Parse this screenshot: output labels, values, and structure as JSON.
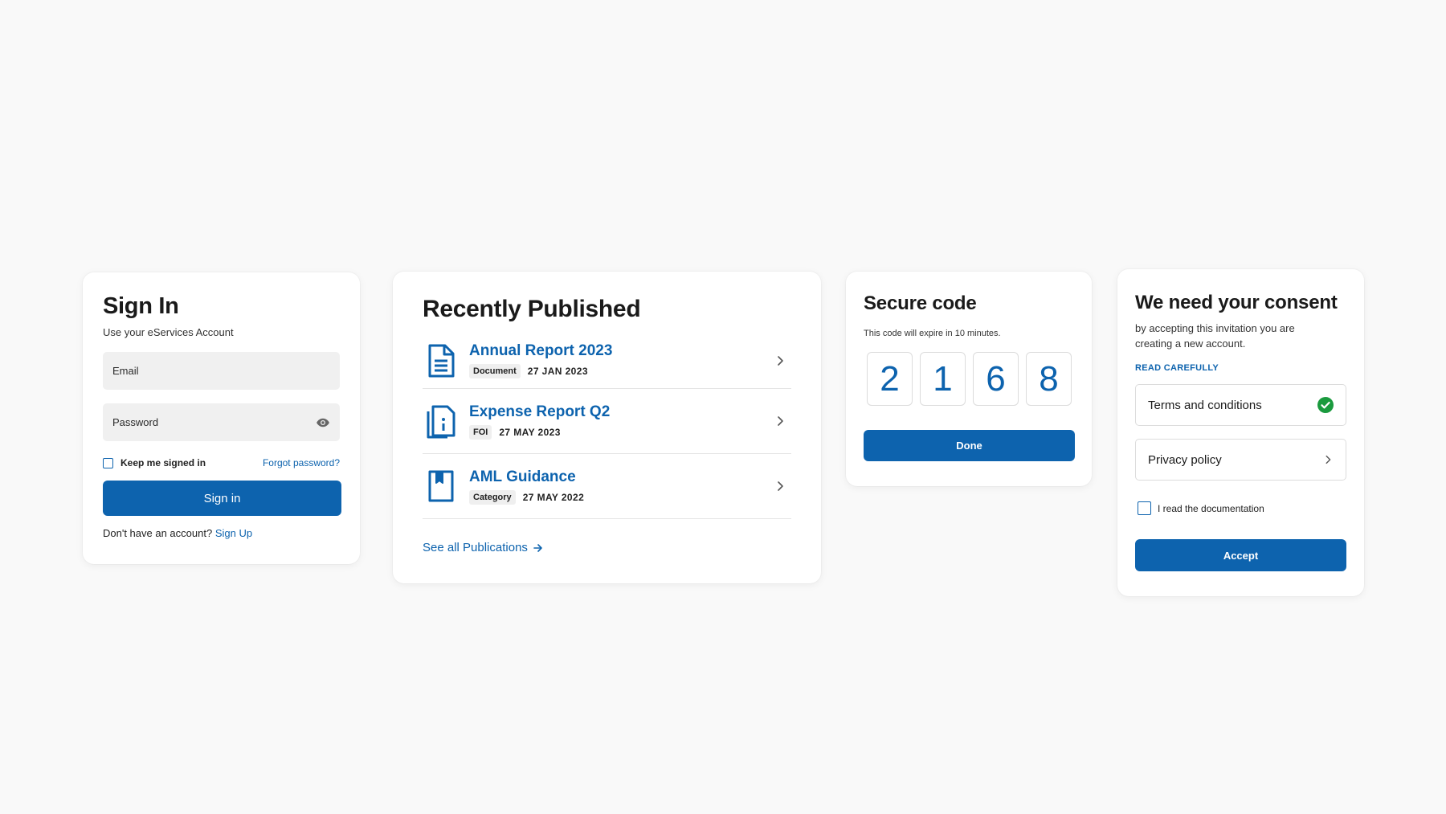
{
  "colors": {
    "accent": "#0d63ae",
    "success": "#1a9a3e",
    "background": "#f9f9f9"
  },
  "signin": {
    "title": "Sign In",
    "subtitle": "Use your eServices Account",
    "email_placeholder": "Email",
    "password_placeholder": "Password",
    "password_icon": "eye-icon",
    "keep_signed_in": "Keep me signed in",
    "forgot_password": "Forgot password?",
    "sign_in_button": "Sign in",
    "no_account": "Don't have an account?",
    "sign_up": "Sign Up"
  },
  "publications": {
    "title": "Recently Published",
    "items": [
      {
        "title": "Annual Report 2023",
        "tag": "Document",
        "date": "27 JAN 2023",
        "icon": "document-icon"
      },
      {
        "title": "Expense Report Q2",
        "tag": "FOI",
        "date": "27 MAY 2023",
        "icon": "info-document-icon"
      },
      {
        "title": "AML Guidance",
        "tag": "Category",
        "date": "27 MAY 2022",
        "icon": "bookmark-icon"
      }
    ],
    "see_all": "See all Publications"
  },
  "secure_code": {
    "title": "Secure code",
    "subtitle": "This code will expire in 10 minutes.",
    "digits": [
      "2",
      "1",
      "6",
      "8"
    ],
    "done_button": "Done"
  },
  "consent": {
    "title": "We need your consent",
    "subtitle": "by accepting this invitation you are creating a new account.",
    "read_carefully": "READ CAREFULLY",
    "terms": "Terms and conditions",
    "terms_status": "checked",
    "privacy": "Privacy policy",
    "read_doc": "I read the documentation",
    "accept_button": "Accept"
  }
}
